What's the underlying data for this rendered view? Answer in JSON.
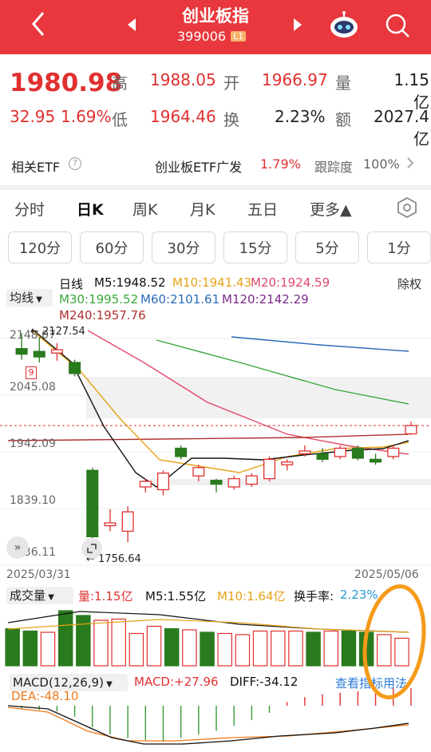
{
  "header": {
    "title": "创业板指",
    "code": "399006",
    "level_badge": "L1",
    "icons": [
      "back-icon",
      "prev-arrow-icon",
      "next-arrow-icon",
      "robot-assistant-icon",
      "search-icon"
    ]
  },
  "quote": {
    "price": "1980.98",
    "change": "32.95",
    "change_pct": "1.69%",
    "high_label": "高",
    "high": "1988.05",
    "open_label": "开",
    "open": "1966.97",
    "vol_label": "量",
    "vol": "1.15亿",
    "low_label": "低",
    "low": "1964.46",
    "turnover_label": "换",
    "turnover": "2.23%",
    "amount_label": "额",
    "amount": "2027.4亿"
  },
  "etf": {
    "label": "相关ETF",
    "name": "创业板ETF广发",
    "pct": "1.79%",
    "track_label": "跟踪度",
    "track": "100%"
  },
  "tabs": [
    {
      "label": "分时",
      "active": false
    },
    {
      "label": "日K",
      "active": true
    },
    {
      "label": "周K",
      "active": false
    },
    {
      "label": "月K",
      "active": false
    },
    {
      "label": "五日",
      "active": false
    },
    {
      "label": "更多▲",
      "active": false
    }
  ],
  "periods": [
    "120分",
    "60分",
    "30分",
    "15分",
    "5分",
    "1分"
  ],
  "ma_legend": {
    "avg_button": "均线",
    "day_line": "日线",
    "m5": "M5:1948.52",
    "m10": "M10:1941.43",
    "m20": "M20:1924.59",
    "adjust": "除权",
    "m30": "M30:1995.52",
    "m60": "M60:2101.61",
    "m120": "M120:2142.29",
    "m240": "M240:1957.76"
  },
  "price_axis": [
    "2148.07",
    "2045.08",
    "1942.09",
    "1839.10",
    "1736.11"
  ],
  "annotations": {
    "high_mark": "2127.54",
    "low_mark": "1756.64",
    "event_badge": "9"
  },
  "dates": {
    "start": "2025/03/31",
    "end": "2025/05/06"
  },
  "volume": {
    "button": "成交量",
    "vol": "量:1.15亿",
    "m5": "M5:1.55亿",
    "m10": "M10:1.64亿",
    "turnover_label": "换手率:",
    "turnover": "2.23%"
  },
  "macd": {
    "button": "MACD(12,26,9)",
    "macd": "MACD:+27.96",
    "diff": "DIFF:-34.12",
    "dea": "DEA:-48.10",
    "link": "查看指标用法"
  },
  "colors": {
    "up": "#e03030",
    "down": "#2a7a1e",
    "header": "#e8383d",
    "m10": "#e6a317",
    "m20": "#e04a6a",
    "m30": "#3aa63a",
    "m60": "#2a6aba",
    "m120": "#7a2a8a",
    "m240": "#b03030"
  },
  "chart_data": {
    "type": "candlestick",
    "dates_shown": [
      "2025/03/31",
      "2025/05/06"
    ],
    "candles": [
      {
        "o": 2120,
        "h": 2148,
        "l": 2100,
        "c": 2110
      },
      {
        "o": 2115,
        "h": 2140,
        "l": 2095,
        "c": 2105
      },
      {
        "o": 2112,
        "h": 2130,
        "l": 2098,
        "c": 2118
      },
      {
        "o": 2095,
        "h": 2100,
        "l": 2070,
        "c": 2075
      },
      {
        "o": 1900,
        "h": 1905,
        "l": 1760,
        "c": 1780
      },
      {
        "o": 1800,
        "h": 1830,
        "l": 1790,
        "c": 1805
      },
      {
        "o": 1790,
        "h": 1835,
        "l": 1770,
        "c": 1825
      },
      {
        "o": 1870,
        "h": 1885,
        "l": 1860,
        "c": 1880
      },
      {
        "o": 1865,
        "h": 1900,
        "l": 1855,
        "c": 1895
      },
      {
        "o": 1940,
        "h": 1945,
        "l": 1920,
        "c": 1925
      },
      {
        "o": 1890,
        "h": 1910,
        "l": 1880,
        "c": 1905
      },
      {
        "o": 1882,
        "h": 1885,
        "l": 1860,
        "c": 1875
      },
      {
        "o": 1870,
        "h": 1890,
        "l": 1865,
        "c": 1885
      },
      {
        "o": 1875,
        "h": 1895,
        "l": 1870,
        "c": 1890
      },
      {
        "o": 1885,
        "h": 1925,
        "l": 1880,
        "c": 1920
      },
      {
        "o": 1910,
        "h": 1920,
        "l": 1900,
        "c": 1915
      },
      {
        "o": 1930,
        "h": 1945,
        "l": 1925,
        "c": 1935
      },
      {
        "o": 1930,
        "h": 1940,
        "l": 1915,
        "c": 1920
      },
      {
        "o": 1925,
        "h": 1945,
        "l": 1920,
        "c": 1940
      },
      {
        "o": 1940,
        "h": 1945,
        "l": 1918,
        "c": 1922
      },
      {
        "o": 1920,
        "h": 1930,
        "l": 1910,
        "c": 1915
      },
      {
        "o": 1925,
        "h": 1945,
        "l": 1920,
        "c": 1940
      },
      {
        "o": 1966,
        "h": 1988,
        "l": 1964,
        "c": 1981
      }
    ],
    "volume_values": [
      1.55,
      1.45,
      1.4,
      2.3,
      2.1,
      1.9,
      1.95,
      1.35,
      1.65,
      1.55,
      1.5,
      1.4,
      1.35,
      1.3,
      1.45,
      1.45,
      1.45,
      1.4,
      1.45,
      1.45,
      1.4,
      1.3,
      1.15
    ],
    "macd_values": [
      -5,
      -6,
      -8,
      -15,
      -30,
      -40,
      -45,
      -48,
      -50,
      -45,
      -40,
      -35,
      -28,
      -20,
      -10,
      5,
      12,
      16,
      18,
      20,
      22,
      25,
      28
    ]
  }
}
